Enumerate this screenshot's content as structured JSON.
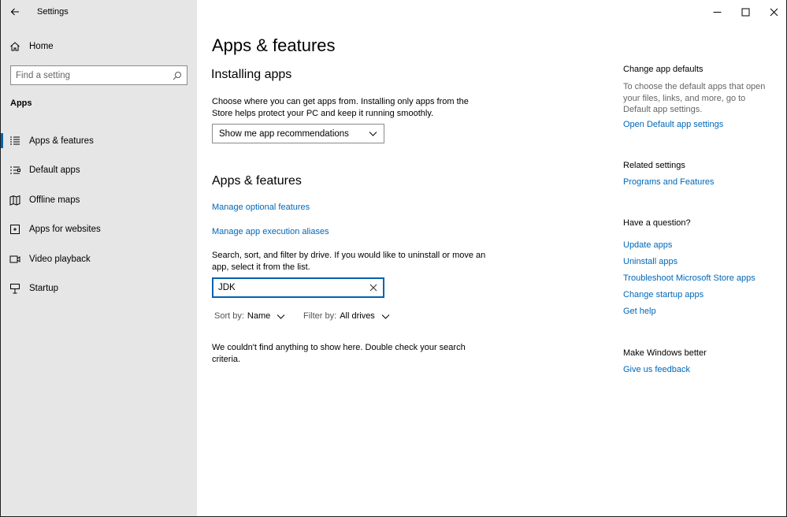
{
  "window": {
    "title": "Settings"
  },
  "sidebar": {
    "home_label": "Home",
    "search_placeholder": "Find a setting",
    "section_title": "Apps",
    "items": [
      {
        "label": "Apps & features",
        "icon": "list-icon",
        "active": true
      },
      {
        "label": "Default apps",
        "icon": "default-apps-icon",
        "active": false
      },
      {
        "label": "Offline maps",
        "icon": "map-icon",
        "active": false
      },
      {
        "label": "Apps for websites",
        "icon": "web-app-icon",
        "active": false
      },
      {
        "label": "Video playback",
        "icon": "video-icon",
        "active": false
      },
      {
        "label": "Startup",
        "icon": "startup-icon",
        "active": false
      }
    ]
  },
  "main": {
    "page_title": "Apps & features",
    "installing": {
      "heading": "Installing apps",
      "description": "Choose where you can get apps from. Installing only apps from the Store helps protect your PC and keep it running smoothly.",
      "dropdown_value": "Show me app recommendations"
    },
    "features": {
      "heading": "Apps & features",
      "link_optional": "Manage optional features",
      "link_aliases": "Manage app execution aliases",
      "filter_description": "Search, sort, and filter by drive. If you would like to uninstall or move an app, select it from the list.",
      "search_value": "JDK",
      "sort_label": "Sort by:",
      "sort_value": "Name",
      "filter_label": "Filter by:",
      "filter_value": "All drives",
      "empty_message": "We couldn't find anything to show here. Double check your search criteria."
    }
  },
  "right": {
    "defaults_heading": "Change app defaults",
    "defaults_text": "To choose the default apps that open your files, links, and more, go to Default app settings.",
    "defaults_link": "Open Default app settings",
    "related_heading": "Related settings",
    "related_link": "Programs and Features",
    "question_heading": "Have a question?",
    "question_links": [
      "Update apps",
      "Uninstall apps",
      "Troubleshoot Microsoft Store apps",
      "Change startup apps",
      "Get help"
    ],
    "better_heading": "Make Windows better",
    "feedback_link": "Give us feedback"
  },
  "colors": {
    "accent": "#0063b1",
    "link": "#0067b8",
    "sidebar_bg": "#e6e6e6"
  }
}
